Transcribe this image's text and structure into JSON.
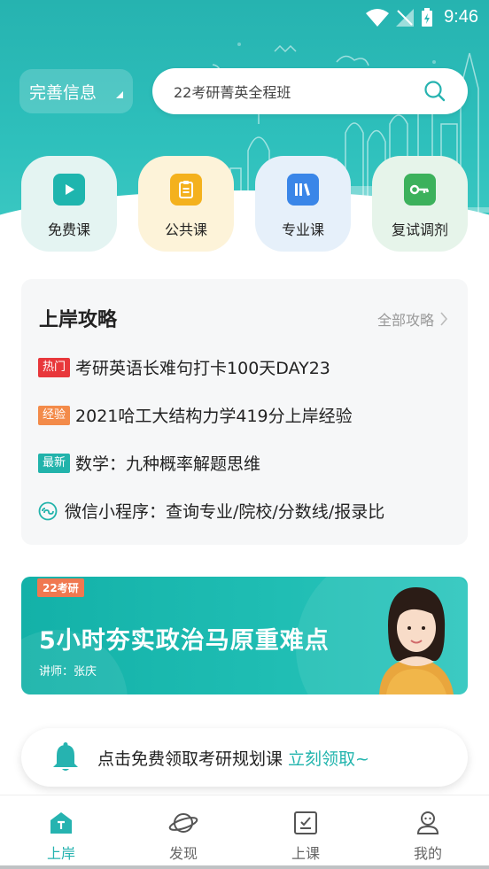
{
  "status_bar": {
    "time": "9:46"
  },
  "header": {
    "profile_button": "完善信息",
    "search": {
      "value": "22考研菁英全程班"
    }
  },
  "categories": [
    {
      "label": "免费课",
      "icon": "play-icon",
      "bg": "#e4f4f2",
      "icon_color": "#1eb5ae"
    },
    {
      "label": "公共课",
      "icon": "document-icon",
      "bg": "#fdf3d9",
      "icon_color": "#f4b11d"
    },
    {
      "label": "专业课",
      "icon": "books-icon",
      "bg": "#e6f0fa",
      "icon_color": "#3a86e8"
    },
    {
      "label": "复试调剂",
      "icon": "key-icon",
      "bg": "#e6f4ea",
      "icon_color": "#3cb15c"
    }
  ],
  "strategy": {
    "title": "上岸攻略",
    "more": "全部攻略",
    "items": [
      {
        "tag": "热门",
        "tag_color": "#e8373b",
        "text": "考研英语长难句打卡100天DAY23"
      },
      {
        "tag": "经验",
        "tag_color": "#f38b4a",
        "text": "2021哈工大结构力学419分上岸经验"
      },
      {
        "tag": "最新",
        "tag_color": "#22b3ab",
        "text": "数学：九种概率解题思维"
      },
      {
        "tag": "",
        "icon": "mini-program-icon",
        "text": "微信小程序：查询专业/院校/分数线/报录比"
      }
    ]
  },
  "banner": {
    "tag": "22考研",
    "title": "5小时夯实政治马原重难点",
    "teacher": "讲师：张庆"
  },
  "notice": {
    "text": "点击免费领取考研规划课",
    "link": "立刻领取~"
  },
  "bottom_nav": [
    {
      "label": "上岸",
      "icon": "home-icon",
      "active": true
    },
    {
      "label": "发现",
      "icon": "planet-icon",
      "active": false
    },
    {
      "label": "上课",
      "icon": "class-icon",
      "active": false
    },
    {
      "label": "我的",
      "icon": "profile-icon",
      "active": false
    }
  ],
  "colors": {
    "primary": "#26b3b0",
    "hot": "#e8373b",
    "experience": "#f38b4a",
    "latest": "#22b3ab"
  }
}
